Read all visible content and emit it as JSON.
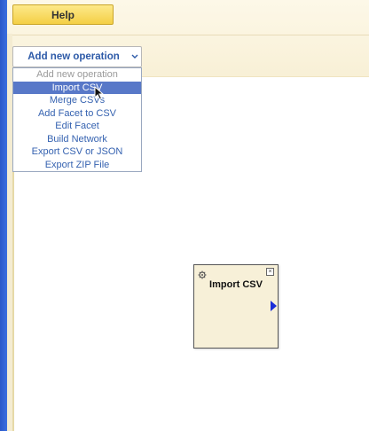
{
  "toolbar": {
    "help_label": "Help"
  },
  "operation_select": {
    "label": "Add new operation",
    "options": [
      "Add new operation",
      "Import CSV",
      "Merge CSVs",
      "Add Facet to CSV",
      "Edit Facet",
      "Build Network",
      "Export CSV or JSON",
      "Export ZIP File"
    ],
    "selected_index": 1
  },
  "node": {
    "title": "Import CSV"
  },
  "colors": {
    "window_edge": "#2a58c8",
    "help_button": "#f4cf45",
    "toolbar_bg": "#fdf8e8",
    "option_text": "#3562b0",
    "selected_option_bg": "#5878c8",
    "node_bg": "#f7f0d8",
    "output_port": "#1a2dd8"
  },
  "icons": {
    "select_chevron": "chevron-down-icon",
    "node_settings": "gear-icon",
    "node_close": "close-icon",
    "node_output": "triangle-right-icon",
    "pointer": "mouse-pointer-icon"
  }
}
